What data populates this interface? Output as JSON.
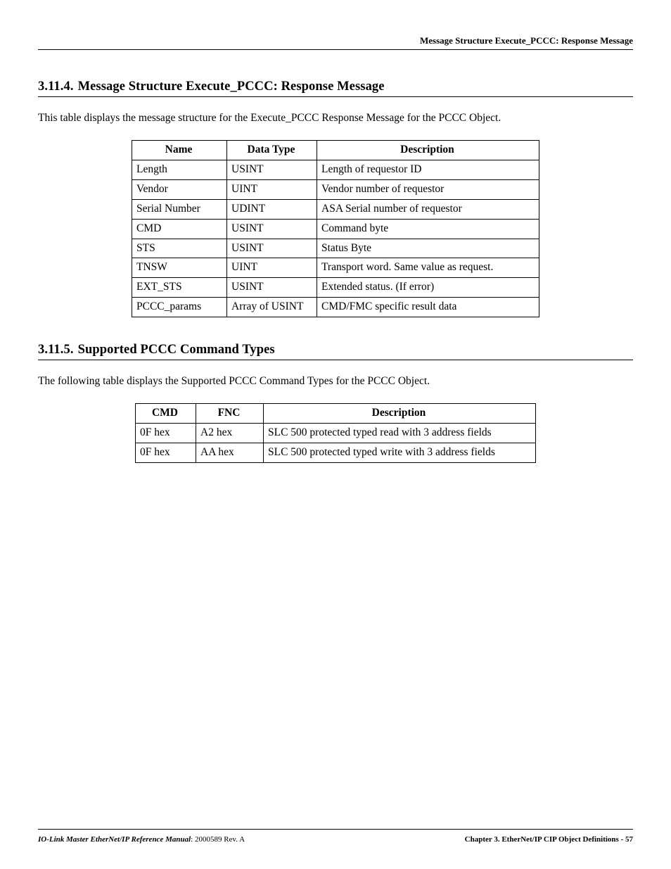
{
  "header": {
    "running_title": "Message Structure Execute_PCCC: Response Message"
  },
  "section1": {
    "number": "3.11.4.",
    "title": "Message Structure Execute_PCCC: Response Message",
    "intro": "This table displays the message structure for the Execute_PCCC Response Message for the PCCC Object.",
    "headers": {
      "c1": "Name",
      "c2": "Data Type",
      "c3": "Description"
    },
    "rows": [
      {
        "c1": "Length",
        "c2": "USINT",
        "c3": "Length of requestor ID"
      },
      {
        "c1": "Vendor",
        "c2": "UINT",
        "c3": "Vendor number of requestor"
      },
      {
        "c1": "Serial Number",
        "c2": "UDINT",
        "c3": "ASA Serial number of requestor"
      },
      {
        "c1": "CMD",
        "c2": "USINT",
        "c3": "Command byte"
      },
      {
        "c1": "STS",
        "c2": "USINT",
        "c3": "Status Byte"
      },
      {
        "c1": "TNSW",
        "c2": "UINT",
        "c3": "Transport word. Same value as request."
      },
      {
        "c1": "EXT_STS",
        "c2": "USINT",
        "c3": "Extended status. (If error)"
      },
      {
        "c1": "PCCC_params",
        "c2": "Array of USINT",
        "c3": "CMD/FMC specific result data"
      }
    ]
  },
  "section2": {
    "number": "3.11.5.",
    "title": "Supported PCCC Command Types",
    "intro": "The following table displays the Supported PCCC Command Types for the PCCC Object.",
    "headers": {
      "c1": "CMD",
      "c2": "FNC",
      "c3": "Description"
    },
    "rows": [
      {
        "c1": "0F hex",
        "c2": "A2 hex",
        "c3": "SLC 500 protected typed read with 3 address fields"
      },
      {
        "c1": "0F hex",
        "c2": "AA hex",
        "c3": "SLC 500 protected typed write with 3 address fields"
      }
    ]
  },
  "footer": {
    "left_em": "IO-Link Master EtherNet/IP Reference Manual",
    "left_rest": ": 2000589 Rev. A",
    "right": "Chapter 3. EtherNet/IP CIP Object Definitions  - 57"
  }
}
